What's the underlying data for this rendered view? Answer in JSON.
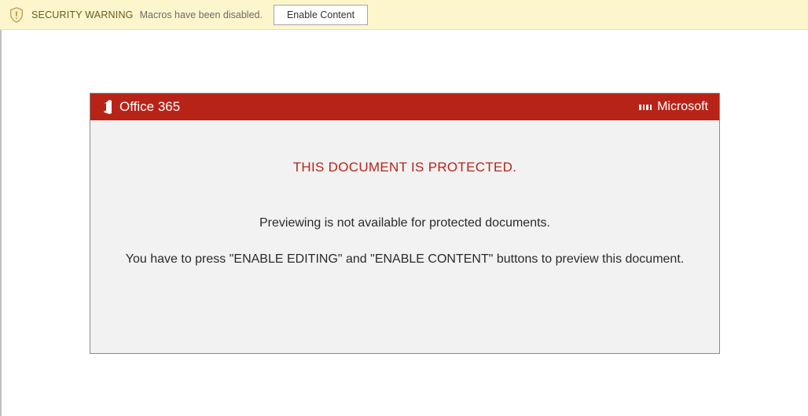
{
  "security_bar": {
    "warning_label": "SECURITY WARNING",
    "message": "Macros have been disabled.",
    "enable_button_label": "Enable Content"
  },
  "document": {
    "header": {
      "left_brand": "Office 365",
      "right_brand": "Microsoft"
    },
    "body": {
      "heading": "THIS DOCUMENT IS PROTECTED.",
      "line1": "Previewing is not available for protected documents.",
      "line2": "You have to press \"ENABLE EDITING\" and \"ENABLE CONTENT\" buttons to preview this document."
    }
  }
}
